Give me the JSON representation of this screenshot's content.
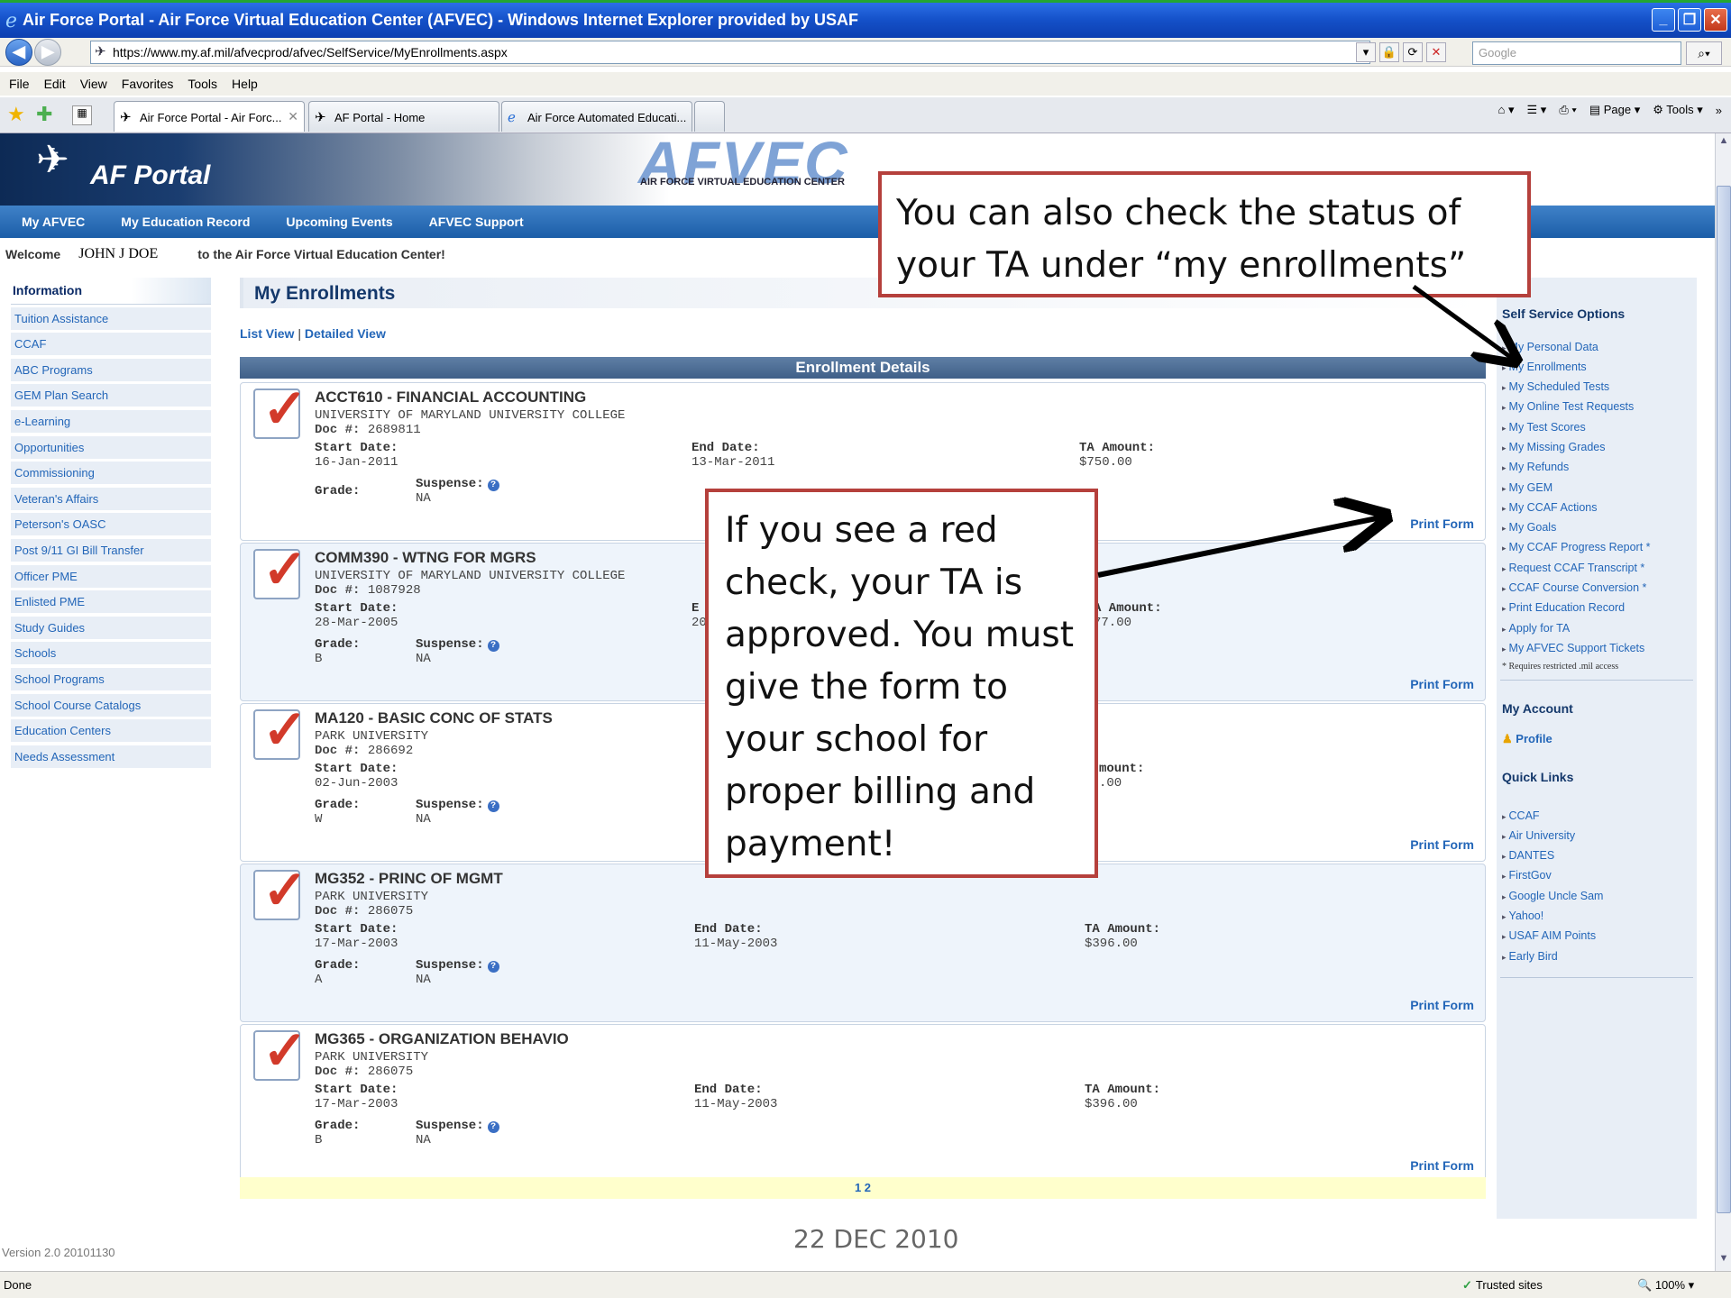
{
  "window": {
    "title": "Air Force Portal - Air Force Virtual Education Center (AFVEC) - Windows Internet Explorer provided by USAF",
    "url": "https://www.my.af.mil/afvecprod/afvec/SelfService/MyEnrollments.aspx",
    "search_placeholder": "Google",
    "menu": [
      "File",
      "Edit",
      "View",
      "Favorites",
      "Tools",
      "Help"
    ],
    "tabs": [
      "Air Force Portal - Air Forc...",
      "AF Portal - Home",
      "Air Force Automated Educati..."
    ],
    "cmd_page": "Page",
    "cmd_tools": "Tools"
  },
  "banner": {
    "portal_label": "AF Portal",
    "afvec_logo": "AFVEC",
    "afvec_subtitle": "AIR FORCE VIRTUAL EDUCATION CENTER"
  },
  "topnav": [
    "My AFVEC",
    "My Education Record",
    "Upcoming Events",
    "AFVEC Support"
  ],
  "welcome": {
    "prefix": "Welcome",
    "name": "JOHN J DOE",
    "suffix": "to the Air Force Virtual Education Center!"
  },
  "leftnav": {
    "heading": "Information",
    "items": [
      "Tuition Assistance",
      "CCAF",
      "ABC Programs",
      "GEM Plan Search",
      "e-Learning",
      "Opportunities",
      "Commissioning",
      "Veteran's Affairs",
      "Peterson's OASC",
      "Post 9/11 GI Bill Transfer",
      "Officer PME",
      "Enlisted PME",
      "Study Guides",
      "Schools",
      "School Programs",
      "School Course Catalogs",
      "Education Centers",
      "Needs Assessment"
    ]
  },
  "main": {
    "title": "My Enrollments",
    "list_view": "List View",
    "separator": "|",
    "detailed_view": "Detailed View",
    "section_header": "Enrollment Details",
    "labels": {
      "doc": "Doc #:",
      "start": "Start Date:",
      "end": "End Date:",
      "ta": "TA Amount:",
      "grade": "Grade:",
      "suspense": "Suspense:",
      "print": "Print Form"
    },
    "courses": [
      {
        "title": "ACCT610 - FINANCIAL ACCOUNTING",
        "school": "UNIVERSITY OF MARYLAND UNIVERSITY COLLEGE",
        "doc": "2689811",
        "start": "16-Jan-2011",
        "end": "13-Mar-2011",
        "ta": "$750.00",
        "grade": "",
        "suspense": "NA"
      },
      {
        "title": "COMM390 - WTNG FOR MGRS",
        "school": "UNIVERSITY OF MARYLAND UNIVERSITY COLLEGE",
        "doc": "1087928",
        "start": "28-Mar-2005",
        "end": "20",
        "ta": "77.00",
        "grade": "B",
        "suspense": "NA"
      },
      {
        "title": "MA120 - BASIC CONC OF STATS",
        "school": "PARK UNIVERSITY",
        "doc": "286692",
        "start": "02-Jun-2003",
        "end": "",
        "ta": ".00",
        "grade": "W",
        "suspense": "NA"
      },
      {
        "title": "MG352 - PRINC OF MGMT",
        "school": "PARK UNIVERSITY",
        "doc": "286075",
        "start": "17-Mar-2003",
        "end": "11-May-2003",
        "ta": "$396.00",
        "grade": "A",
        "suspense": "NA"
      },
      {
        "title": "MG365 - ORGANIZATION BEHAVIO",
        "school": "PARK UNIVERSITY",
        "doc": "286075",
        "start": "17-Mar-2003",
        "end": "11-May-2003",
        "ta": "$396.00",
        "grade": "B",
        "suspense": "NA"
      }
    ],
    "pager": "1 2"
  },
  "rightpane": {
    "self_service_heading": "Self Service Options",
    "self_service": [
      "My Personal Data",
      "My Enrollments",
      "My Scheduled Tests",
      "My Online Test Requests",
      "My Test Scores",
      "My Missing Grades",
      "My Refunds",
      "My GEM",
      "My CCAF Actions",
      "My Goals",
      "My CCAF Progress Report *",
      "Request CCAF Transcript *",
      "CCAF Course Conversion *",
      "Print Education Record",
      "Apply for TA",
      "My AFVEC Support Tickets"
    ],
    "note": "* Requires restricted .mil access",
    "account_heading": "My Account",
    "profile": "Profile",
    "quick_heading": "Quick Links",
    "quick_links": [
      "CCAF",
      "Air University",
      "DANTES",
      "FirstGov",
      "Google Uncle Sam",
      "Yahoo!",
      "USAF AIM Points",
      "Early Bird"
    ]
  },
  "callouts": {
    "enrollments": "You can also check the status of your TA under “my enrollments”",
    "red_check": "If you see a red check, your TA is approved. You must give the form to your school for proper billing and payment!"
  },
  "version": "Version 2.0 20101130",
  "slide_date": "22 DEC 2010",
  "status": {
    "left": "Done",
    "zone": "Trusted sites",
    "zoom": "100%"
  }
}
